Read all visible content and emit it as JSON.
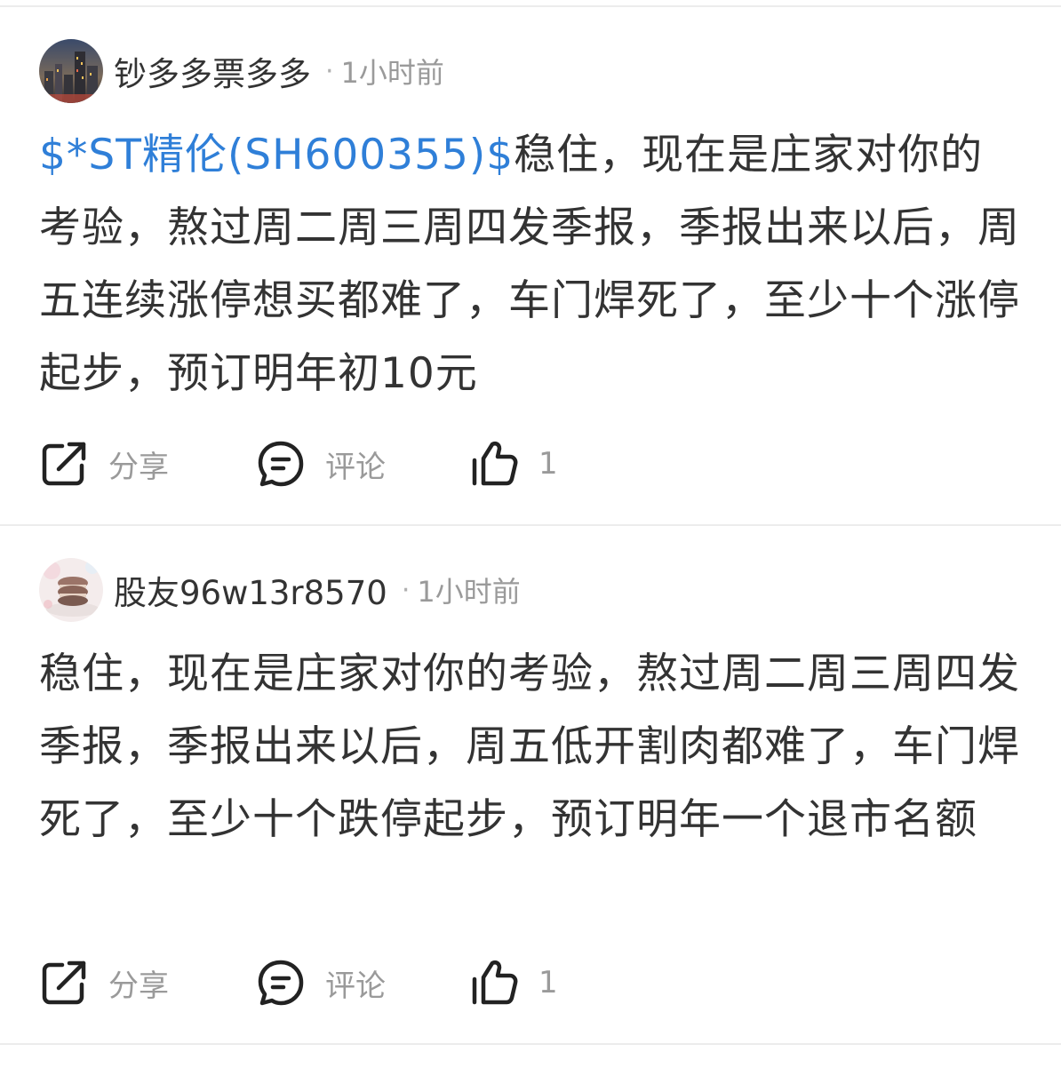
{
  "posts": [
    {
      "username": "钞多多票多多",
      "dot": "·",
      "time": "1小时前",
      "stock_tag": "$*ST精伦(SH600355)$",
      "body": "稳住，现在是庄家对你的考验，熬过周二周三周四发季报，季报出来以后，周五连续涨停想买都难了，车门焊死了，至少十个涨停起步，预订明年初10元",
      "actions": {
        "share_label": "分享",
        "comment_label": "评论",
        "like_count": "1"
      }
    },
    {
      "username": "股友96w13r8570",
      "dot": "·",
      "time": "1小时前",
      "body": "稳住，现在是庄家对你的考验，熬过周二周三周四发季报，季报出来以后，周五低开割肉都难了，车门焊死了，至少十个跌停起步，预订明年一个退市名额",
      "actions": {
        "share_label": "分享",
        "comment_label": "评论",
        "like_count": "1"
      }
    }
  ],
  "colors": {
    "stock_link": "#2f7fd8",
    "body_text": "#333333",
    "meta_text": "#9a9a9a",
    "divider": "#ececec"
  },
  "icons": {
    "share": "share-icon",
    "comment": "comment-icon",
    "like": "thumbs-up-icon"
  }
}
